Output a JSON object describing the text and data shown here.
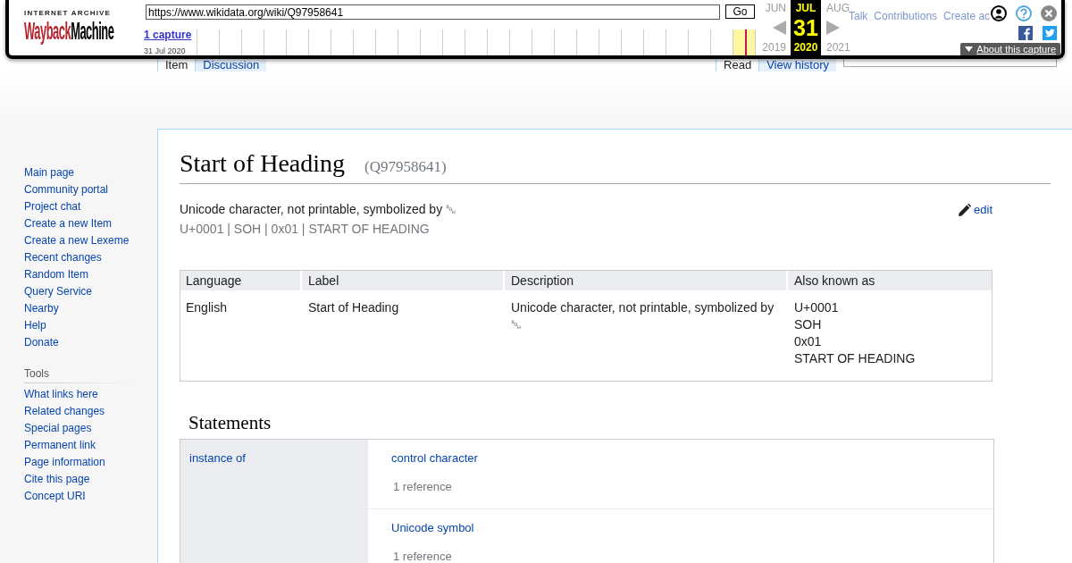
{
  "wayback": {
    "logo": {
      "caption": "INTERNET ARCHIVE",
      "wordmark": [
        "Wayback",
        "Machine"
      ]
    },
    "url": "https://www.wikidata.org/wiki/Q97958641",
    "go_button": "Go",
    "captures": "1 capture",
    "capture_date": "31 Jul 2020",
    "months": [
      {
        "month": "JUN",
        "year": "2019",
        "selected": false
      },
      {
        "month": "JUL",
        "day": "31",
        "year": "2020",
        "selected": true
      },
      {
        "month": "AUG",
        "year": "2021",
        "selected": false
      }
    ],
    "about_button": "About this capture"
  },
  "personal_tools": [
    "Talk",
    "Contributions",
    "Create ac"
  ],
  "tabs": {
    "left": [
      {
        "label": "Item",
        "selected": true
      },
      {
        "label": "Discussion",
        "selected": false
      }
    ],
    "right": [
      {
        "label": "Read",
        "selected": true
      },
      {
        "label": "View history",
        "selected": false
      }
    ]
  },
  "sidebar": {
    "navigation": [
      "Main page",
      "Community portal",
      "Project chat",
      "Create a new Item",
      "Create a new Lexeme",
      "Recent changes",
      "Random Item",
      "Query Service",
      "Nearby",
      "Help",
      "Donate"
    ],
    "tools": {
      "heading": "Tools",
      "items": [
        "What links here",
        "Related changes",
        "Special pages",
        "Permanent link",
        "Page information",
        "Cite this page",
        "Concept URI"
      ]
    }
  },
  "item": {
    "title": "Start of Heading",
    "id": "(Q97958641)",
    "description": "Unicode character, not printable, symbolized by ␁",
    "aliases": "U+0001 | SOH | 0x01 | START OF HEADING",
    "edit_link": "edit"
  },
  "terms_table": {
    "columns": [
      "Language",
      "Label",
      "Description",
      "Also known as"
    ],
    "rows": [
      {
        "language": "English",
        "label": "Start of Heading",
        "description": "Unicode character, not printable, symbolized by ␁",
        "aliases": [
          "U+0001",
          "SOH",
          "0x01",
          "START OF HEADING"
        ]
      }
    ]
  },
  "statements": {
    "heading": "Statements",
    "groups": [
      {
        "property": "instance of",
        "values": [
          {
            "value": "control character",
            "references": "1 reference"
          },
          {
            "value": "Unicode symbol",
            "references": "1 reference"
          }
        ]
      }
    ]
  }
}
